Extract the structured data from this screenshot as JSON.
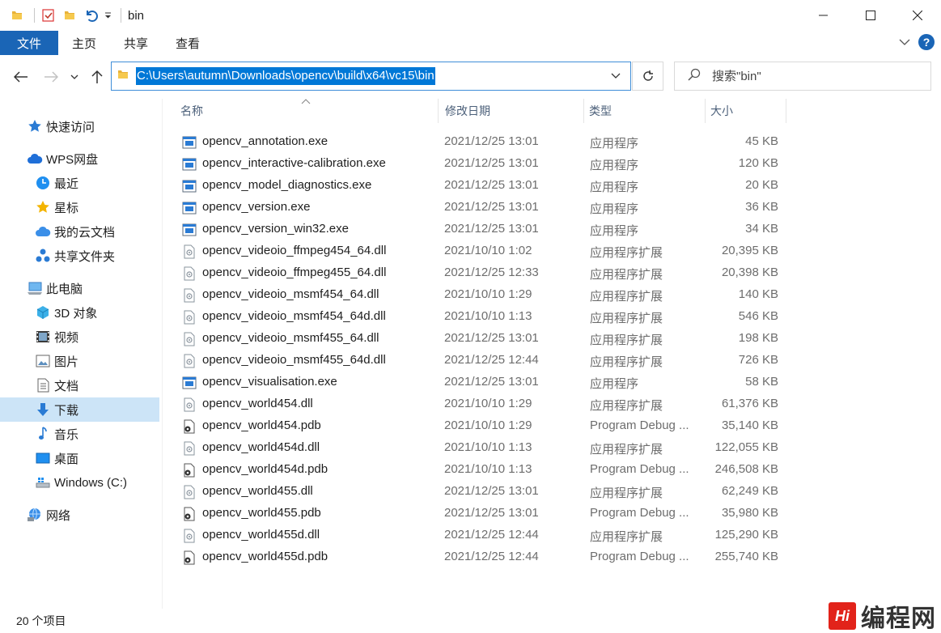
{
  "window": {
    "title": "bin",
    "min_icon": "minimize-icon",
    "max_icon": "maximize-icon",
    "close_icon": "close-icon"
  },
  "ribbon": {
    "tabs": [
      "文件",
      "主页",
      "共享",
      "查看"
    ],
    "accent": "#1a65b6",
    "help_label": "?"
  },
  "address": {
    "path": "C:\\Users\\autumn\\Downloads\\opencv\\build\\x64\\vc15\\bin",
    "selection_color": "#0078d7"
  },
  "search": {
    "placeholder": "搜索\"bin\""
  },
  "sidebar": {
    "items": [
      {
        "label": "快速访问",
        "icon": "star-icon"
      },
      {
        "label": "WPS网盘",
        "icon": "cloud-icon"
      },
      {
        "label": "最近",
        "icon": "clock-icon"
      },
      {
        "label": "星标",
        "icon": "star-icon"
      },
      {
        "label": "我的云文档",
        "icon": "cloud-doc-icon"
      },
      {
        "label": "共享文件夹",
        "icon": "share-icon"
      },
      {
        "label": "此电脑",
        "icon": "computer-icon"
      },
      {
        "label": "3D 对象",
        "icon": "cube-icon"
      },
      {
        "label": "视频",
        "icon": "video-icon"
      },
      {
        "label": "图片",
        "icon": "picture-icon"
      },
      {
        "label": "文档",
        "icon": "document-icon"
      },
      {
        "label": "下载",
        "icon": "download-icon"
      },
      {
        "label": "音乐",
        "icon": "music-icon"
      },
      {
        "label": "桌面",
        "icon": "desktop-icon"
      },
      {
        "label": "Windows (C:)",
        "icon": "drive-icon"
      },
      {
        "label": "网络",
        "icon": "network-icon"
      }
    ],
    "selected": "下载"
  },
  "columns": [
    "名称",
    "修改日期",
    "类型",
    "大小"
  ],
  "files": [
    {
      "name": "opencv_annotation.exe",
      "date": "2021/12/25 13:01",
      "type": "应用程序",
      "size": "45 KB",
      "kind": "exe"
    },
    {
      "name": "opencv_interactive-calibration.exe",
      "date": "2021/12/25 13:01",
      "type": "应用程序",
      "size": "120 KB",
      "kind": "exe"
    },
    {
      "name": "opencv_model_diagnostics.exe",
      "date": "2021/12/25 13:01",
      "type": "应用程序",
      "size": "20 KB",
      "kind": "exe"
    },
    {
      "name": "opencv_version.exe",
      "date": "2021/12/25 13:01",
      "type": "应用程序",
      "size": "36 KB",
      "kind": "exe"
    },
    {
      "name": "opencv_version_win32.exe",
      "date": "2021/12/25 13:01",
      "type": "应用程序",
      "size": "34 KB",
      "kind": "exe"
    },
    {
      "name": "opencv_videoio_ffmpeg454_64.dll",
      "date": "2021/10/10 1:02",
      "type": "应用程序扩展",
      "size": "20,395 KB",
      "kind": "dll"
    },
    {
      "name": "opencv_videoio_ffmpeg455_64.dll",
      "date": "2021/12/25 12:33",
      "type": "应用程序扩展",
      "size": "20,398 KB",
      "kind": "dll"
    },
    {
      "name": "opencv_videoio_msmf454_64.dll",
      "date": "2021/10/10 1:29",
      "type": "应用程序扩展",
      "size": "140 KB",
      "kind": "dll"
    },
    {
      "name": "opencv_videoio_msmf454_64d.dll",
      "date": "2021/10/10 1:13",
      "type": "应用程序扩展",
      "size": "546 KB",
      "kind": "dll"
    },
    {
      "name": "opencv_videoio_msmf455_64.dll",
      "date": "2021/12/25 13:01",
      "type": "应用程序扩展",
      "size": "198 KB",
      "kind": "dll"
    },
    {
      "name": "opencv_videoio_msmf455_64d.dll",
      "date": "2021/12/25 12:44",
      "type": "应用程序扩展",
      "size": "726 KB",
      "kind": "dll"
    },
    {
      "name": "opencv_visualisation.exe",
      "date": "2021/12/25 13:01",
      "type": "应用程序",
      "size": "58 KB",
      "kind": "exe"
    },
    {
      "name": "opencv_world454.dll",
      "date": "2021/10/10 1:29",
      "type": "应用程序扩展",
      "size": "61,376 KB",
      "kind": "dll"
    },
    {
      "name": "opencv_world454.pdb",
      "date": "2021/10/10 1:29",
      "type": "Program Debug ...",
      "size": "35,140 KB",
      "kind": "pdb"
    },
    {
      "name": "opencv_world454d.dll",
      "date": "2021/10/10 1:13",
      "type": "应用程序扩展",
      "size": "122,055 KB",
      "kind": "dll"
    },
    {
      "name": "opencv_world454d.pdb",
      "date": "2021/10/10 1:13",
      "type": "Program Debug ...",
      "size": "246,508 KB",
      "kind": "pdb"
    },
    {
      "name": "opencv_world455.dll",
      "date": "2021/12/25 13:01",
      "type": "应用程序扩展",
      "size": "62,249 KB",
      "kind": "dll"
    },
    {
      "name": "opencv_world455.pdb",
      "date": "2021/12/25 13:01",
      "type": "Program Debug ...",
      "size": "35,980 KB",
      "kind": "pdb"
    },
    {
      "name": "opencv_world455d.dll",
      "date": "2021/12/25 12:44",
      "type": "应用程序扩展",
      "size": "125,290 KB",
      "kind": "dll"
    },
    {
      "name": "opencv_world455d.pdb",
      "date": "2021/12/25 12:44",
      "type": "Program Debug ...",
      "size": "255,740 KB",
      "kind": "pdb"
    }
  ],
  "status": {
    "count": "20 个项目"
  },
  "watermark": {
    "logo": "Hi",
    "text": "编程网"
  }
}
